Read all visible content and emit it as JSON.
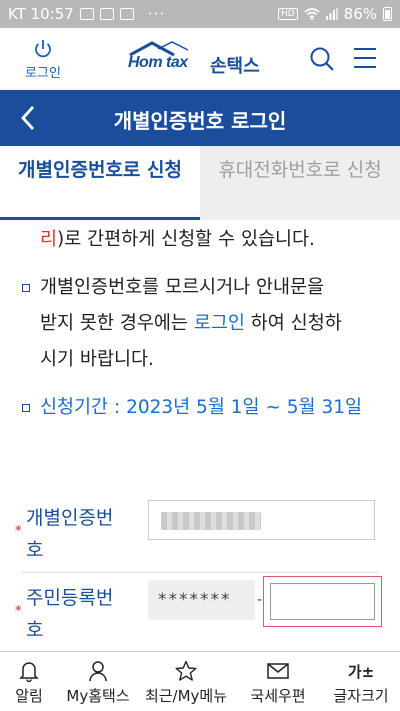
{
  "status_bar": {
    "carrier_time": "KT 10:57",
    "dots": "···",
    "hd": "HD",
    "battery_text": "86%"
  },
  "header": {
    "login_label": "로그인",
    "logo_brand": "Hom tax",
    "logo_brand_kr": "손택스"
  },
  "titlebar": {
    "title": "개별인증번호 로그인"
  },
  "tabs": [
    {
      "label": "개별인증번호로 신청",
      "active": true
    },
    {
      "label": "휴대전화번호로 신청",
      "active": false
    }
  ],
  "content": {
    "line1_red": "리",
    "line1_rest": ")로 간편하게 신청할 수 있습니다.",
    "bullet2_line1": "개별인증번호를 모르시거나 안내문을",
    "bullet2_line2_a": "받지 못한 경우에는 ",
    "bullet2_line2_link": "로그인",
    "bullet2_line2_b": " 하여 신청하",
    "bullet2_line3": "시기 바랍니다.",
    "bullet3": "신청기간 : 2023년 5월 1일 ~ 5월 31일"
  },
  "form": {
    "field1_label_line1": "개별인증번",
    "field1_label_line2": "호",
    "field2_label_line1": "주민등록번",
    "field2_label_line2": "호",
    "required_mark": "*",
    "resident_masked": "*******",
    "resident_dash": "-"
  },
  "bottom_nav": [
    {
      "label": "알림",
      "icon": "bell-icon"
    },
    {
      "label": "My홈택스",
      "icon": "person-icon"
    },
    {
      "label": "최근/My메뉴",
      "icon": "star-icon"
    },
    {
      "label": "국세우편",
      "icon": "mail-icon"
    },
    {
      "label": "글자크기",
      "icon": "font-size-icon",
      "icon_text": "가±"
    }
  ],
  "colors": {
    "brand_blue": "#1a4e9c",
    "link_blue": "#1a6fce",
    "accent_red": "#e03030"
  }
}
